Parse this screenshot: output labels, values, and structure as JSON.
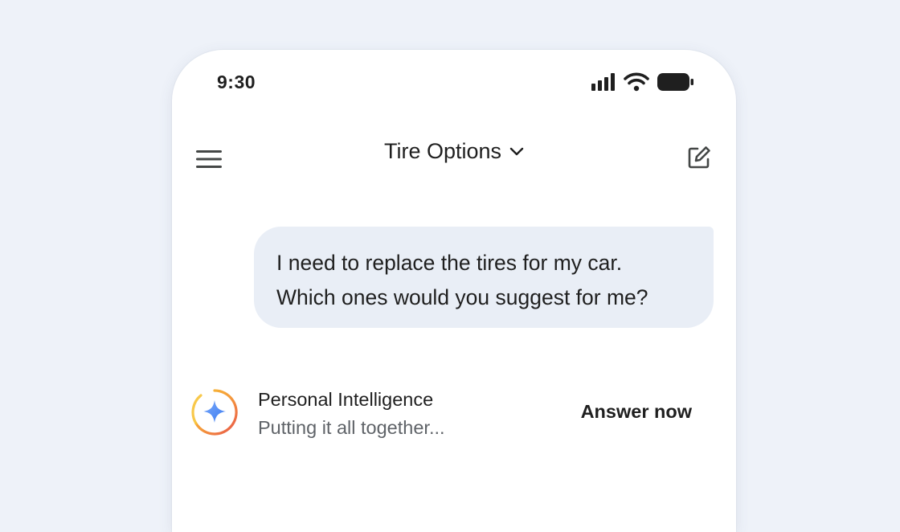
{
  "status_bar": {
    "time": "9:30",
    "icons": [
      "signal-icon",
      "wifi-icon",
      "battery-icon"
    ]
  },
  "app_bar": {
    "menu_icon": "menu-icon",
    "title": "Tire Options",
    "title_icon": "chevron-down-icon",
    "new_chat_icon": "edit-icon"
  },
  "conversation": {
    "user_message_lines": [
      "I need to replace the tires for my car.",
      "Which ones would you suggest for me?"
    ],
    "response": {
      "icon": "sparkle-icon",
      "title": "Personal Intelligence",
      "status": "Putting it all together...",
      "action_label": "Answer now"
    }
  },
  "colors": {
    "page_background": "#eef2f9",
    "phone_surface": "#ffffff",
    "bubble": "#e9eef6",
    "text_primary": "#1f1f1f",
    "text_secondary": "#5f6368",
    "spark_blue": "#4c8df6"
  }
}
